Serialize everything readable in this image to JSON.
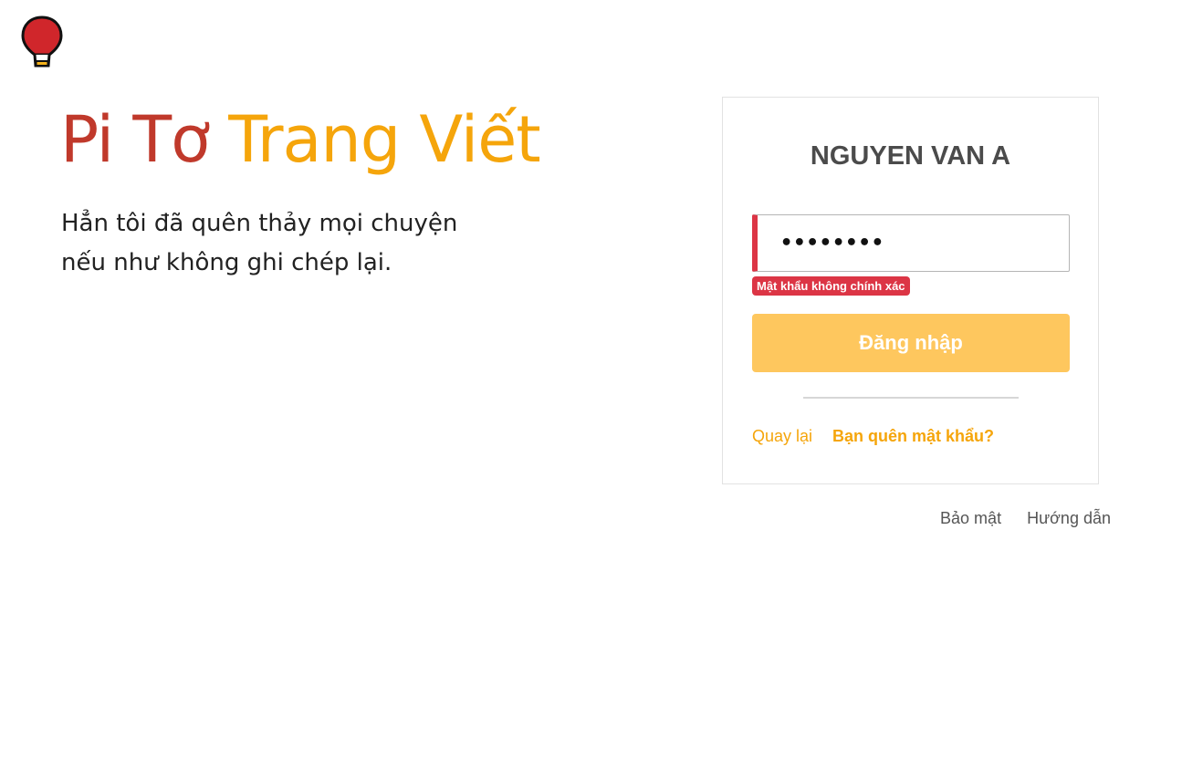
{
  "brand": {
    "logo_icon": "hot-air-balloon-icon",
    "title_part1": "Pi Tơ",
    "title_part2": "Trang Viết",
    "tagline_line1": "Hẳn tôi đã quên thảy mọi chuyện",
    "tagline_line2": "nếu như không ghi chép lại.",
    "colors": {
      "red": "#c0392b",
      "orange": "#f5a50b"
    }
  },
  "login": {
    "username": "NGUYEN VAN A",
    "password_value": "••••••••",
    "error_message": "Mật khẩu không chính xác",
    "submit_label": "Đăng nhập",
    "back_label": "Quay lại",
    "forgot_label": "Bạn quên mật khẩu?",
    "colors": {
      "error": "#dc3545",
      "button": "#fec75e",
      "link": "#f5a50b"
    }
  },
  "footer": {
    "privacy_label": "Bảo mật",
    "guide_label": "Hướng dẫn"
  }
}
